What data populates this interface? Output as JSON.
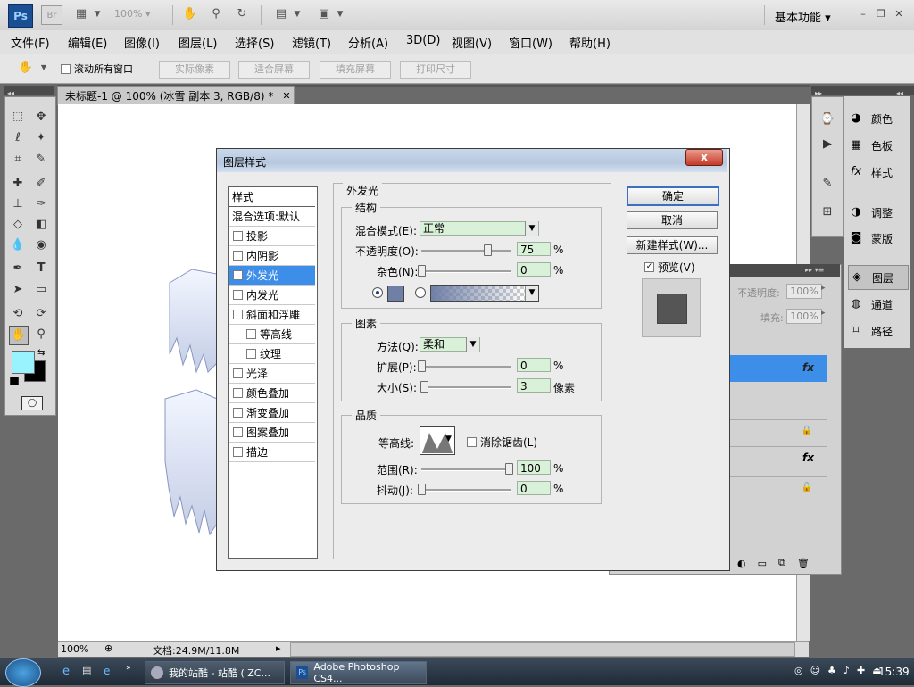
{
  "app": {
    "logo_ps": "Ps",
    "logo_br": "Br",
    "zoom": "100%",
    "workspace": "基本功能"
  },
  "menu": [
    "文件(F)",
    "编辑(E)",
    "图像(I)",
    "图层(L)",
    "选择(S)",
    "滤镜(T)",
    "分析(A)",
    "3D(D)",
    "视图(V)",
    "窗口(W)",
    "帮助(H)"
  ],
  "options_bar": {
    "scroll_all": "滚动所有窗口",
    "buttons": [
      "实际像素",
      "适合屏幕",
      "填充屏幕",
      "打印尺寸"
    ]
  },
  "document": {
    "tab_title": "未标题-1 @ 100% (冰雪 副本 3, RGB/8) *",
    "status_zoom": "100%",
    "doc_size": "文档:24.9M/11.8M"
  },
  "dock": {
    "items": [
      "颜色",
      "色板",
      "样式",
      "调整",
      "蒙版",
      "图层",
      "通道",
      "路径"
    ]
  },
  "layers_panel": {
    "opacity_label": "不透明度:",
    "opacity_value": "100%",
    "fill_label": "填充:",
    "fill_value": "100%"
  },
  "dialog": {
    "title": "图层样式",
    "close": "x",
    "style_list": [
      {
        "label": "样式",
        "header": true
      },
      {
        "label": "混合选项:默认",
        "header": true
      },
      {
        "label": "投影",
        "checked": false
      },
      {
        "label": "内阴影",
        "checked": false
      },
      {
        "label": "外发光",
        "checked": true,
        "selected": true
      },
      {
        "label": "内发光",
        "checked": false
      },
      {
        "label": "斜面和浮雕",
        "checked": false
      },
      {
        "label": "等高线",
        "checked": false,
        "indent": true
      },
      {
        "label": "纹理",
        "checked": false,
        "indent": true
      },
      {
        "label": "光泽",
        "checked": false
      },
      {
        "label": "颜色叠加",
        "checked": false
      },
      {
        "label": "渐变叠加",
        "checked": false
      },
      {
        "label": "图案叠加",
        "checked": false
      },
      {
        "label": "描边",
        "checked": false
      }
    ],
    "section_title": "外发光",
    "structure": {
      "title": "结构",
      "blend_mode_label": "混合模式(E):",
      "blend_mode_value": "正常",
      "opacity_label": "不透明度(O):",
      "opacity_value": "75",
      "noise_label": "杂色(N):",
      "noise_value": "0",
      "percent": "%",
      "glow_color": "#6f7fa6"
    },
    "elements": {
      "title": "图素",
      "method_label": "方法(Q):",
      "method_value": "柔和",
      "spread_label": "扩展(P):",
      "spread_value": "0",
      "size_label": "大小(S):",
      "size_value": "3",
      "pixel_unit": "像素"
    },
    "quality": {
      "title": "品质",
      "contour_label": "等高线:",
      "antialias_label": "消除锯齿(L)",
      "range_label": "范围(R):",
      "range_value": "100",
      "jitter_label": "抖动(J):",
      "jitter_value": "0"
    },
    "buttons": {
      "ok": "确定",
      "cancel": "取消",
      "new_style": "新建样式(W)...",
      "preview": "预览(V)"
    }
  },
  "taskbar": {
    "task1": "我的站酷 - 站酷 ( ZC...",
    "task2": "Adobe Photoshop CS4...",
    "clock": "15:39"
  }
}
